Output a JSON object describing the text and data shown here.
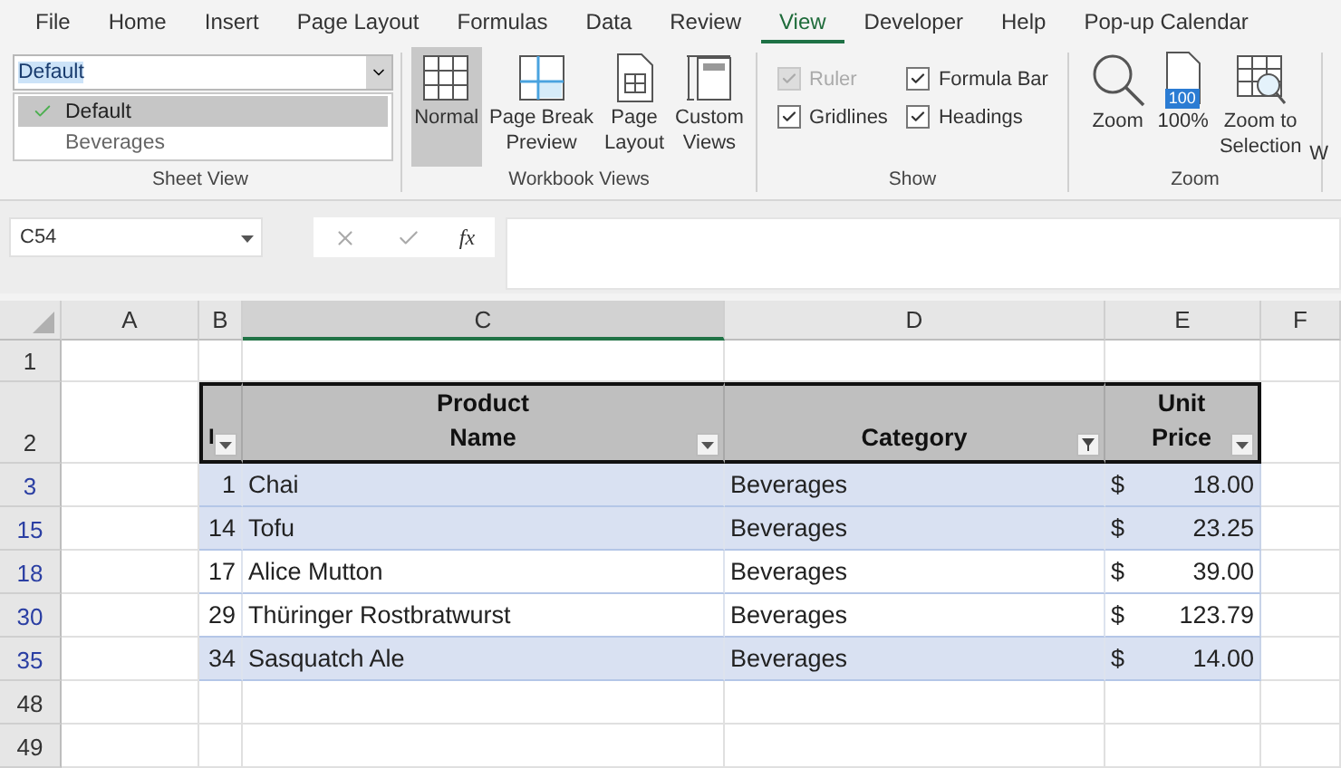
{
  "menu_tabs": [
    {
      "label": "File",
      "selected": false
    },
    {
      "label": "Home",
      "selected": false
    },
    {
      "label": "Insert",
      "selected": false
    },
    {
      "label": "Page Layout",
      "selected": false
    },
    {
      "label": "Formulas",
      "selected": false
    },
    {
      "label": "Data",
      "selected": false
    },
    {
      "label": "Review",
      "selected": false
    },
    {
      "label": "View",
      "selected": true
    },
    {
      "label": "Developer",
      "selected": false
    },
    {
      "label": "Help",
      "selected": false
    },
    {
      "label": "Pop-up Calendar",
      "selected": false
    }
  ],
  "sheet_view": {
    "value": "Default",
    "options": [
      {
        "label": "Default",
        "checked": true
      },
      {
        "label": "Beverages",
        "checked": false
      }
    ],
    "group_label": "Sheet View"
  },
  "workbook_views": {
    "label": "Workbook Views",
    "buttons": [
      {
        "kind": "normal",
        "lines": [
          "Normal"
        ],
        "selected": true
      },
      {
        "kind": "pagebreak",
        "lines": [
          "Page Break",
          "Preview"
        ],
        "selected": false
      },
      {
        "kind": "pagelayout",
        "lines": [
          "Page",
          "Layout"
        ],
        "selected": false
      },
      {
        "kind": "custom",
        "lines": [
          "Custom",
          "Views"
        ],
        "selected": false
      }
    ]
  },
  "show": {
    "label": "Show",
    "checkboxes": [
      {
        "label": "Ruler",
        "checked": true,
        "disabled": true
      },
      {
        "label": "Formula Bar",
        "checked": true,
        "disabled": false
      },
      {
        "label": "Gridlines",
        "checked": true,
        "disabled": false
      },
      {
        "label": "Headings",
        "checked": true,
        "disabled": false
      }
    ]
  },
  "zoom": {
    "label": "Zoom",
    "buttons": [
      {
        "kind": "magnifier",
        "lines": [
          "Zoom"
        ]
      },
      {
        "kind": "hundred",
        "lines": [
          "100%"
        ],
        "badge": "100"
      },
      {
        "kind": "selection",
        "lines": [
          "Zoom to",
          "Selection"
        ]
      }
    ]
  },
  "ribbon_cut_label": "W",
  "formula_bar": {
    "name_box": "C54",
    "function_label": "fx"
  },
  "columns": [
    {
      "label": "A",
      "selected": false
    },
    {
      "label": "B",
      "selected": false
    },
    {
      "label": "C",
      "selected": true
    },
    {
      "label": "D",
      "selected": false
    },
    {
      "label": "E",
      "selected": false
    },
    {
      "label": "F",
      "selected": false
    }
  ],
  "row_1": {
    "row_number": "1"
  },
  "table": {
    "header_row_number": "2",
    "columns": [
      {
        "lines": [
          "I"
        ],
        "filtered": false
      },
      {
        "lines": [
          "Product",
          "Name"
        ],
        "filtered": false
      },
      {
        "lines": [
          "Category"
        ],
        "filtered": true
      },
      {
        "lines": [
          "Unit",
          "Price"
        ],
        "filtered": false
      }
    ],
    "rows": [
      {
        "row_number": "3",
        "banded": true,
        "id": "1",
        "name": "Chai",
        "category": "Beverages",
        "currency": "$",
        "price": "18.00"
      },
      {
        "row_number": "15",
        "banded": true,
        "id": "14",
        "name": "Tofu",
        "category": "Beverages",
        "currency": "$",
        "price": "23.25"
      },
      {
        "row_number": "18",
        "banded": false,
        "id": "17",
        "name": "Alice Mutton",
        "category": "Beverages",
        "currency": "$",
        "price": "39.00"
      },
      {
        "row_number": "30",
        "banded": false,
        "id": "29",
        "name": "Thüringer Rostbratwurst",
        "category": "Beverages",
        "currency": "$",
        "price": "123.79"
      },
      {
        "row_number": "35",
        "banded": true,
        "id": "34",
        "name": "Sasquatch Ale",
        "category": "Beverages",
        "currency": "$",
        "price": "14.00"
      }
    ]
  },
  "empty_rows": [
    {
      "row_number": "48"
    },
    {
      "row_number": "49"
    }
  ]
}
